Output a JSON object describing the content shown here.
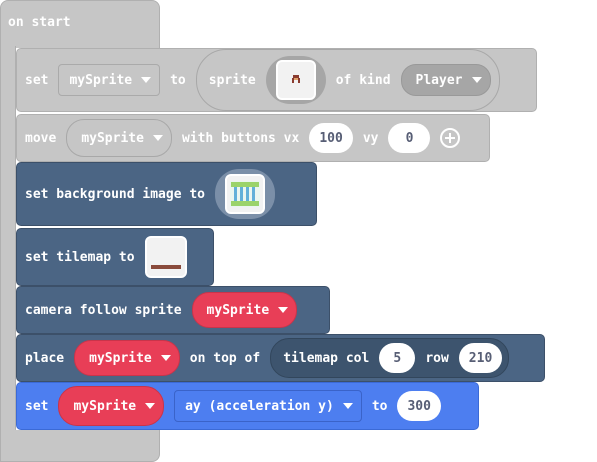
{
  "event": {
    "label": "on start"
  },
  "blocks": {
    "set_sprite": {
      "set": "set",
      "variable": "mySprite",
      "to": "to",
      "sprite": "sprite",
      "of_kind": "of kind",
      "kind": "Player"
    },
    "move": {
      "move": "move",
      "variable": "mySprite",
      "with_buttons": "with buttons vx",
      "vx": "100",
      "vy_label": "vy",
      "vy": "0"
    },
    "background": {
      "label": "set background image to"
    },
    "tilemap": {
      "label": "set tilemap to"
    },
    "camera": {
      "label": "camera follow sprite",
      "variable": "mySprite"
    },
    "place": {
      "place": "place",
      "variable": "mySprite",
      "on_top_of": "on top of",
      "tilemap_col": "tilemap col",
      "col": "5",
      "row_label": "row",
      "row": "210"
    },
    "set_accel": {
      "set": "set",
      "variable": "mySprite",
      "property": "ay (acceleration y)",
      "to": "to",
      "value": "300"
    }
  },
  "colors": {
    "event_gray": "#c6c6c6",
    "scene_navy": "#4b6584",
    "sprite_red": "#e83e57",
    "sprites_blue": "#4d7ef0"
  }
}
